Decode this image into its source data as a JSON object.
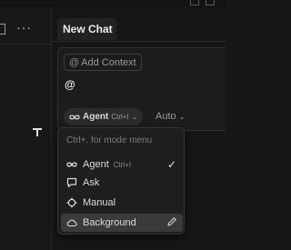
{
  "tab": {
    "title": "New Chat"
  },
  "toolbar": {
    "more_label": "···"
  },
  "composer": {
    "context_button": "Add Context",
    "context_at": "@",
    "typed_text": "@",
    "mode": {
      "name": "Agent",
      "shortcut": "Ctrl+I"
    },
    "model": "Auto"
  },
  "mode_menu": {
    "hint": "Ctrl+. for mode menu",
    "items": [
      {
        "label": "Agent",
        "shortcut": "Ctrl+I",
        "icon": "infinity-icon",
        "checked": true
      },
      {
        "label": "Ask",
        "icon": "chat-bubble-icon"
      },
      {
        "label": "Manual",
        "icon": "crosshair-icon"
      },
      {
        "label": "Background",
        "icon": "cloud-icon",
        "highlighted": true,
        "editable": true
      }
    ]
  },
  "colors": {
    "background": "#161616",
    "menu": "#1e1e1e",
    "highlight": "#3a3a3a",
    "text": "#dcdcdc"
  }
}
